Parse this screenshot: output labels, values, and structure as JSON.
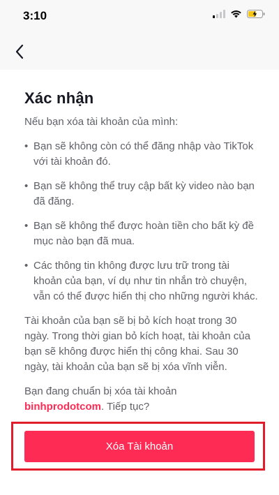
{
  "status_bar": {
    "time": "3:10",
    "battery_color": "#f5c518"
  },
  "nav": {
    "back_icon": "chevron-left-icon"
  },
  "confirm": {
    "title": "Xác nhận",
    "intro": "Nếu bạn xóa tài khoản của mình:",
    "bullets": [
      "Bạn sẽ không còn có thể đăng nhập vào TikTok với tài khoản đó.",
      "Bạn sẽ không thể truy cập bất kỳ video nào bạn đã đăng.",
      "Bạn sẽ không thể được hoàn tiền cho bất kỳ đề mục nào bạn đã mua.",
      "Các thông tin không được lưu trữ trong tài khoản của bạn, ví dụ như tin nhắn trò chuyện, vẫn có thể được hiển thị cho những người khác."
    ],
    "deactivation_text": "Tài khoản của bạn sẽ bị bỏ kích hoạt trong 30 ngày. Trong thời gian bỏ kích hoạt, tài khoản của bạn sẽ không được hiển thị công khai. Sau 30 ngày, tài khoản của bạn sẽ bị xóa vĩnh viễn.",
    "prompt_prefix": "Bạn đang chuẩn bị xóa tài khoản ",
    "username": "binhprodotcom",
    "prompt_suffix": ". Tiếp tục?"
  },
  "action": {
    "delete_label": "Xóa Tài khoản"
  },
  "colors": {
    "accent": "#fe2c55",
    "highlight_border": "#e11d2b",
    "text_muted": "#5f6068"
  }
}
